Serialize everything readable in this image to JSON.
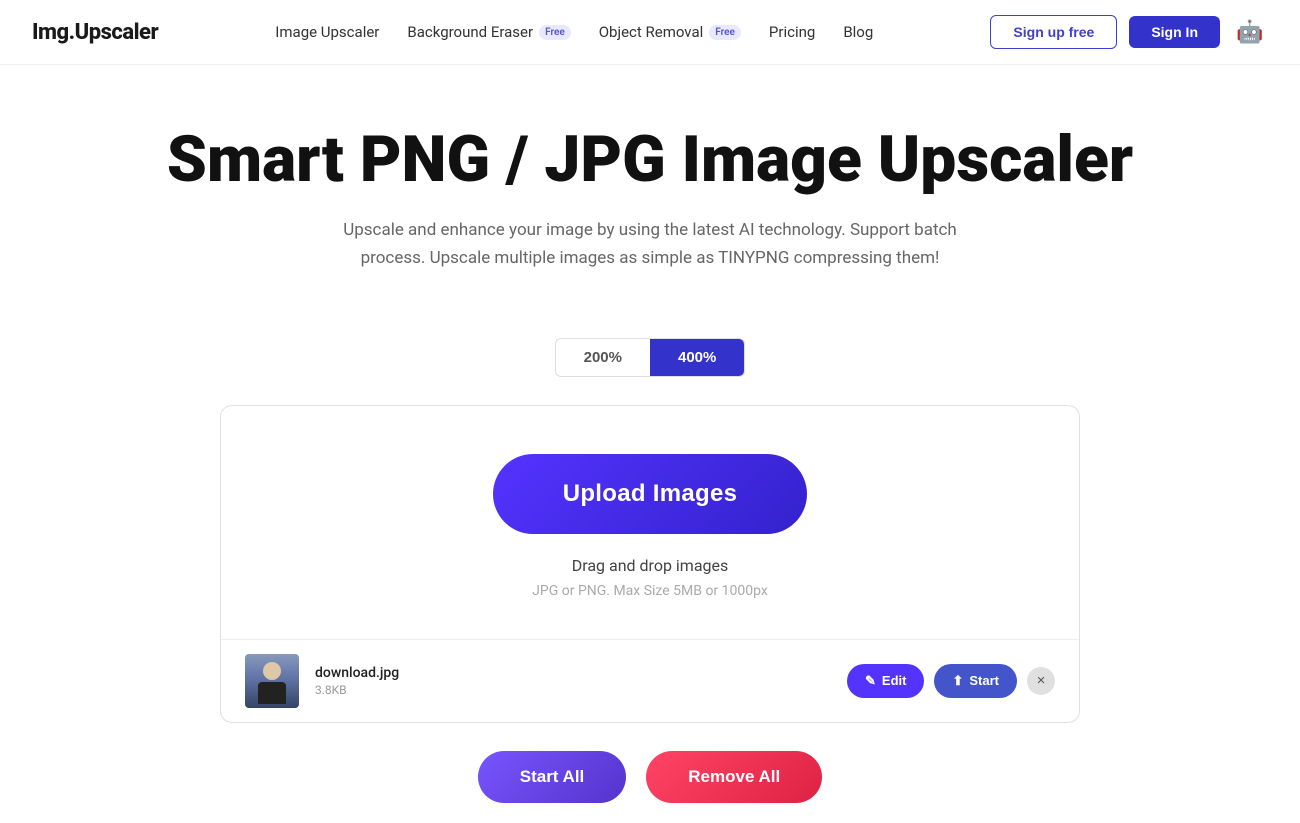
{
  "logo": "Img.Upscaler",
  "nav": {
    "links": [
      {
        "label": "Image Upscaler",
        "id": "image-upscaler",
        "badge": null
      },
      {
        "label": "Background Eraser",
        "id": "background-eraser",
        "badge": "Free"
      },
      {
        "label": "Object Removal",
        "id": "object-removal",
        "badge": "Free"
      },
      {
        "label": "Pricing",
        "id": "pricing",
        "badge": null
      },
      {
        "label": "Blog",
        "id": "blog",
        "badge": null
      }
    ],
    "signup_label": "Sign up free",
    "signin_label": "Sign In"
  },
  "hero": {
    "title": "Smart PNG / JPG Image Upscaler",
    "subtitle": "Upscale and enhance your image by using the latest AI technology. Support batch process. Upscale multiple images as simple as TINYPNG compressing them!"
  },
  "scale_toggle": {
    "options": [
      "200%",
      "400%"
    ],
    "active": "400%"
  },
  "upload": {
    "button_label": "Upload Images",
    "drag_text": "Drag and drop images",
    "hint_text": "JPG or PNG. Max Size 5MB or 1000px"
  },
  "files": [
    {
      "name": "download.jpg",
      "size": "3.8KB"
    }
  ],
  "file_actions": {
    "edit_label": "Edit",
    "start_label": "Start",
    "remove_icon": "×"
  },
  "bottom_actions": {
    "start_all_label": "Start All",
    "remove_all_label": "Remove All"
  }
}
